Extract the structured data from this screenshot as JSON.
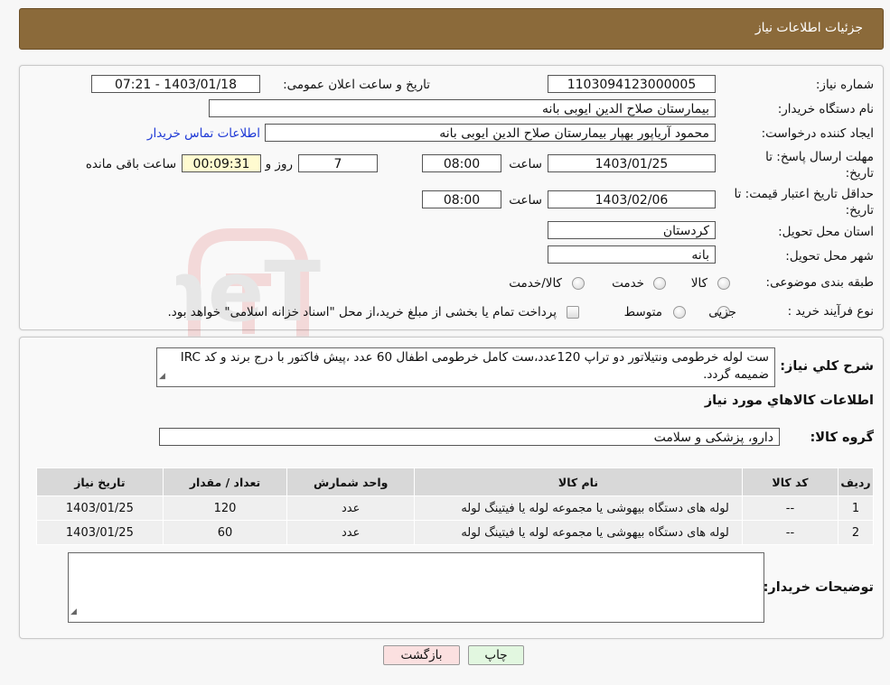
{
  "header": {
    "title": "جزئیات اطلاعات نیاز"
  },
  "form": {
    "need_number_label": "شماره نیاز:",
    "need_number": "1103094123000005",
    "announce_label": "تاریخ و ساعت اعلان عمومی:",
    "announce_value": "1403/01/18 - 07:21",
    "buyer_org_label": "نام دستگاه خریدار:",
    "buyer_org": "بیمارستان صلاح الدین ایوبی بانه",
    "creator_label": "ایجاد کننده درخواست:",
    "creator": "محمود آریاپور بهپار بیمارستان صلاح الدین ایوبی بانه",
    "contact_link": "اطلاعات تماس خریدار",
    "deadline_label_1": "مهلت ارسال پاسخ: تا",
    "deadline_label_2": "تاریخ:",
    "deadline_date": "1403/01/25",
    "time_label": "ساعت",
    "deadline_time": "08:00",
    "days": "7",
    "days_label": "روز و",
    "remaining": "00:09:31",
    "remaining_label": "ساعت باقی مانده",
    "validity_label_1": "حداقل تاریخ اعتبار قیمت: تا",
    "validity_label_2": "تاریخ:",
    "validity_date": "1403/02/06",
    "validity_time": "08:00",
    "province_label": "استان محل تحویل:",
    "province": "کردستان",
    "city_label": "شهر محل تحویل:",
    "city": "بانه",
    "category_label": "طبقه بندی موضوعی:",
    "category_options": [
      "کالا",
      "خدمت",
      "کالا/خدمت"
    ],
    "process_label": "نوع فرآیند خرید :",
    "process_options": [
      "جزیی",
      "متوسط"
    ],
    "payment_note": "پرداخت تمام یا بخشی از مبلغ خرید،از محل \"اسناد خزانه اسلامی\" خواهد بود."
  },
  "details": {
    "summary_label": "شرح کلي نياز:",
    "summary": "ست لوله خرطومی ونتیلاتور دو تراپ 120عدد،ست کامل خرطومی اطفال 60 عدد ،پیش فاکتور با درج برند و کد IRC  ضمیمه گردد.",
    "goods_title": "اطلاعات کالاهاي مورد نياز",
    "group_label": "گروه کالا:",
    "group": "دارو، پزشکی و سلامت",
    "columns": [
      "رديف",
      "کد کالا",
      "نام کالا",
      "واحد شمارش",
      "تعداد / مقدار",
      "تاريخ نياز"
    ],
    "rows": [
      {
        "index": "1",
        "code": "--",
        "name": "لوله های دستگاه بیهوشی یا مجموعه لوله یا فیتینگ لوله",
        "unit": "عدد",
        "qty": "120",
        "date": "1403/01/25"
      },
      {
        "index": "2",
        "code": "--",
        "name": "لوله های دستگاه بیهوشی یا مجموعه لوله یا فیتینگ لوله",
        "unit": "عدد",
        "qty": "60",
        "date": "1403/01/25"
      }
    ],
    "buyer_notes_label": "توضیحات خریدار:",
    "buyer_notes": ""
  },
  "buttons": {
    "print": "چاپ",
    "back": "بازگشت"
  },
  "watermark": {
    "text": "AriaTender.neT"
  },
  "colors": {
    "header_bg": "#8b6a3a",
    "link": "#1d38d6",
    "back_btn": "#fbe0e0",
    "print_btn": "#e2f7e0"
  }
}
